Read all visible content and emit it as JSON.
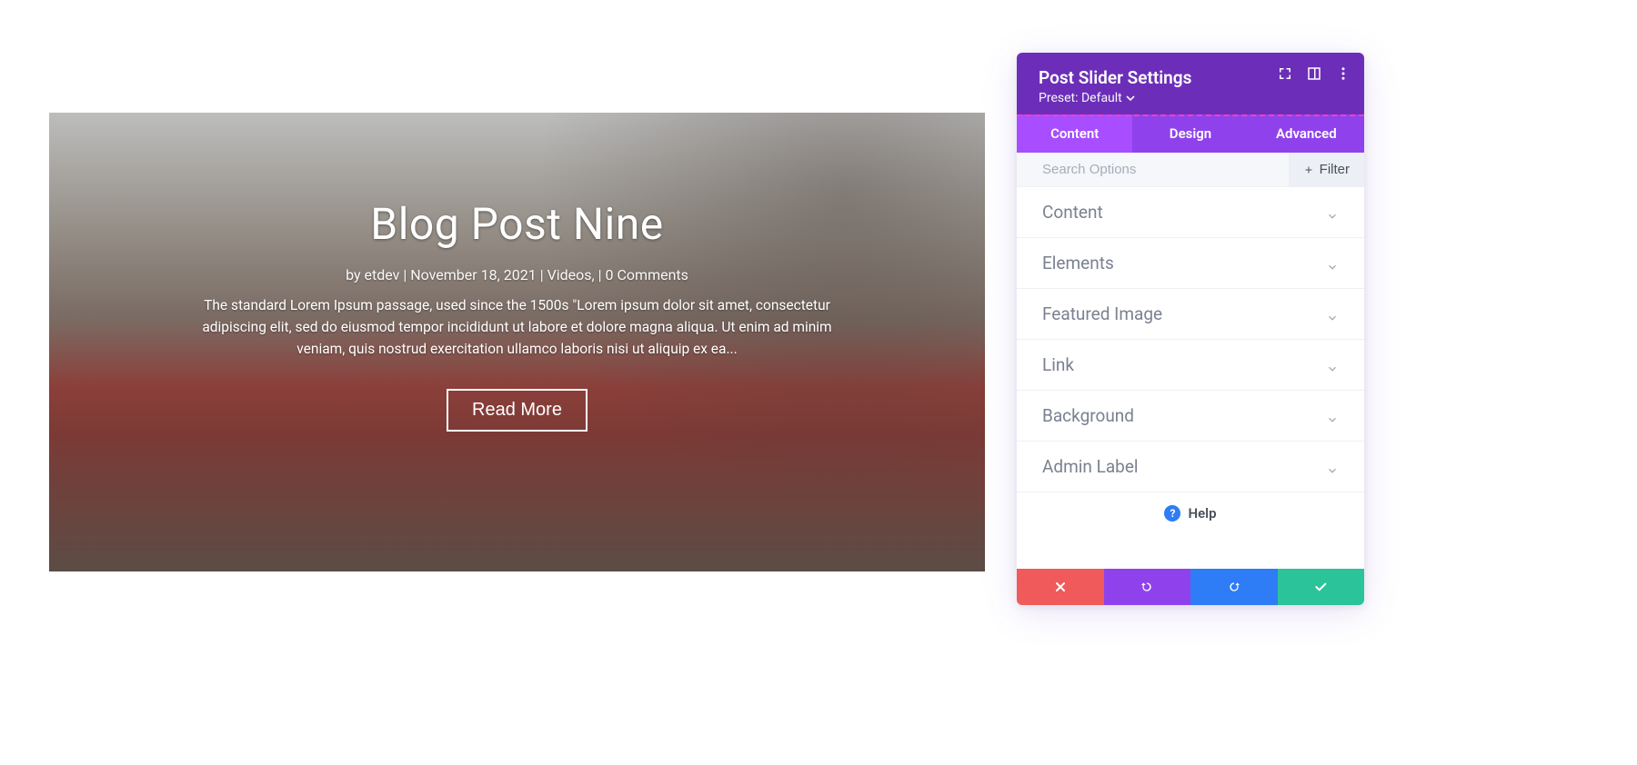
{
  "preview": {
    "title": "Blog Post Nine",
    "meta": "by etdev | November 18, 2021 | Videos, | 0 Comments",
    "excerpt": "The standard Lorem Ipsum passage, used since the 1500s \"Lorem ipsum dolor sit amet, consectetur adipiscing elit, sed do eiusmod tempor incididunt ut labore et dolore magna aliqua. Ut enim ad minim veniam, quis nostrud exercitation ullamco laboris nisi ut aliquip ex ea...",
    "button_label": "Read More"
  },
  "panel": {
    "title": "Post Slider Settings",
    "preset_label": "Preset: Default",
    "tabs": {
      "content": "Content",
      "design": "Design",
      "advanced": "Advanced"
    },
    "search_placeholder": "Search Options",
    "filter_label": "Filter",
    "sections": {
      "content": "Content",
      "elements": "Elements",
      "featured_image": "Featured Image",
      "link": "Link",
      "background": "Background",
      "admin_label": "Admin Label"
    },
    "help_label": "Help"
  },
  "colors": {
    "panel_header": "#6c2eb9",
    "tab_bg": "#8f42ec",
    "tab_active": "#a84dff",
    "cancel": "#f05a5a",
    "undo": "#8f42ec",
    "redo": "#2e7cf6",
    "save": "#2bc49a"
  }
}
